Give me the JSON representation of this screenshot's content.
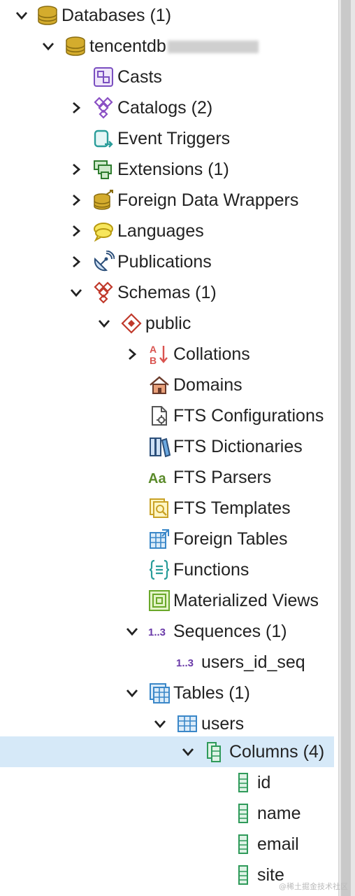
{
  "tree": {
    "databases": "Databases (1)",
    "server": "tencentdb",
    "casts": "Casts",
    "catalogs": "Catalogs (2)",
    "event_triggers": "Event Triggers",
    "extensions": "Extensions (1)",
    "fdw": "Foreign Data Wrappers",
    "languages": "Languages",
    "publications": "Publications",
    "schemas": "Schemas (1)",
    "public": "public",
    "collations": "Collations",
    "domains": "Domains",
    "fts_configurations": "FTS Configurations",
    "fts_dictionaries": "FTS Dictionaries",
    "fts_parsers": "FTS Parsers",
    "fts_templates": "FTS Templates",
    "foreign_tables": "Foreign Tables",
    "functions": "Functions",
    "materialized_views": "Materialized Views",
    "sequences": "Sequences (1)",
    "users_id_seq": "users_id_seq",
    "tables": "Tables (1)",
    "users": "users",
    "columns": "Columns (4)",
    "col_id": "id",
    "col_name": "name",
    "col_email": "email",
    "col_site": "site"
  },
  "icon_text": {
    "sequence": "1..3",
    "parser": "Aa",
    "collation_a": "A",
    "collation_b": "B"
  },
  "watermark": "@稀土掘金技术社区",
  "colors": {
    "selected_bg": "#d6e9f8",
    "scrollbar": "#c9c9c9",
    "db_gold": "#c9a227",
    "purple": "#8a4fc4",
    "red": "#c0392b",
    "teal": "#2a9d9a",
    "green": "#3a9a3a",
    "blue": "#3a87c8",
    "lime": "#8ac43a"
  }
}
